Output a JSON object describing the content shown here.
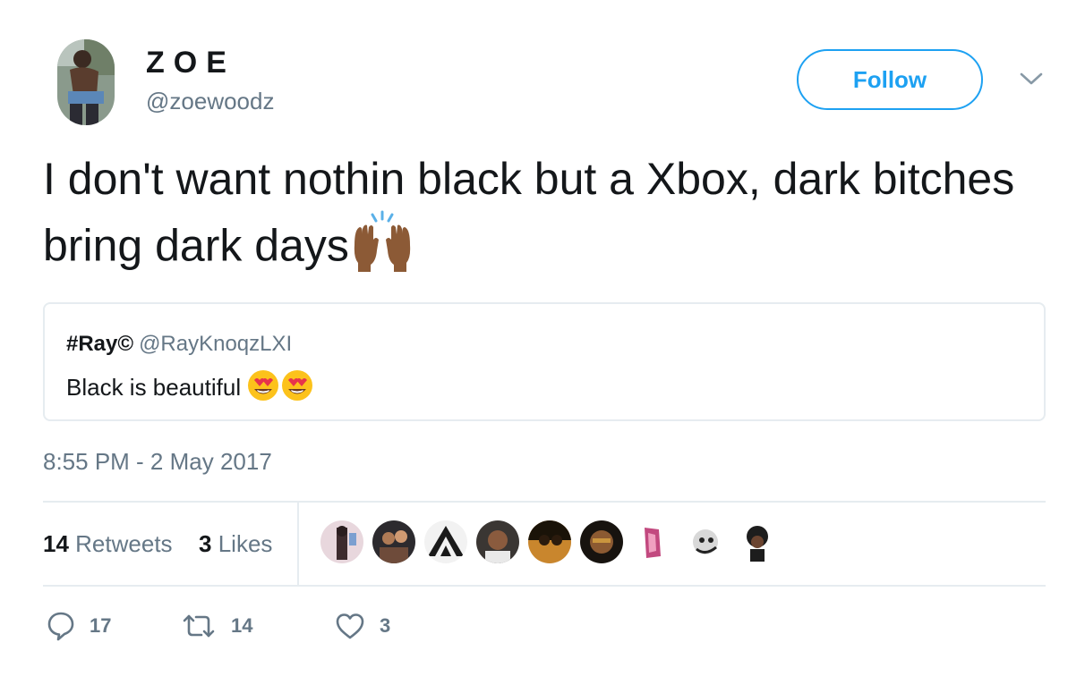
{
  "author": {
    "display_name": "ZOE",
    "handle": "@zoewoodz",
    "avatar_icon": "user-avatar-photo"
  },
  "follow_button": {
    "label": "Follow"
  },
  "menu": {
    "icon": "chevron-down-icon"
  },
  "tweet": {
    "text": "I don't want nothin black but a Xbox, dark bitches bring dark days",
    "emoji": "raised-hands-emoji"
  },
  "quoted_tweet": {
    "name": "#Ray©",
    "handle": "@RayKnoqzLXI",
    "text": "Black is beautiful",
    "emoji": "heart-eyes-emoji"
  },
  "timestamp": "8:55 PM - 2 May 2017",
  "stats": {
    "retweets_count": "14",
    "retweets_label": "Retweets",
    "likes_count": "3",
    "likes_label": "Likes"
  },
  "liker_avatars_count": 9,
  "actions": {
    "replies": "17",
    "retweets": "14",
    "likes": "3"
  },
  "colors": {
    "accent": "#1da1f2",
    "text_primary": "#14171a",
    "text_secondary": "#657786",
    "border": "#e6ecf0"
  }
}
